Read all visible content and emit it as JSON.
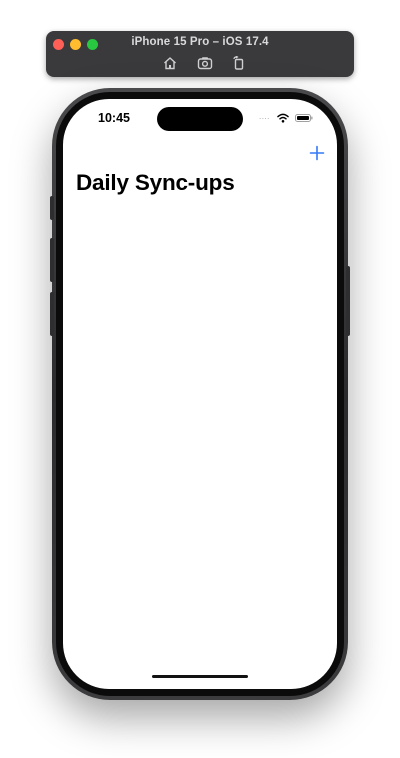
{
  "simulator": {
    "window_title": "iPhone 15 Pro – iOS 17.4",
    "toolbar_icons": [
      "home-icon",
      "screenshot-icon",
      "rotate-icon"
    ]
  },
  "status_bar": {
    "time": "10:45",
    "signal": "....",
    "icons": [
      "wifi-icon",
      "battery-icon"
    ]
  },
  "navigation": {
    "add_button_icon": "plus-icon",
    "title": "Daily Sync-ups"
  },
  "colors": {
    "accent": "#3478f6",
    "toolbar_bg": "#3a3a3c",
    "screen_bg": "#ffffff"
  }
}
